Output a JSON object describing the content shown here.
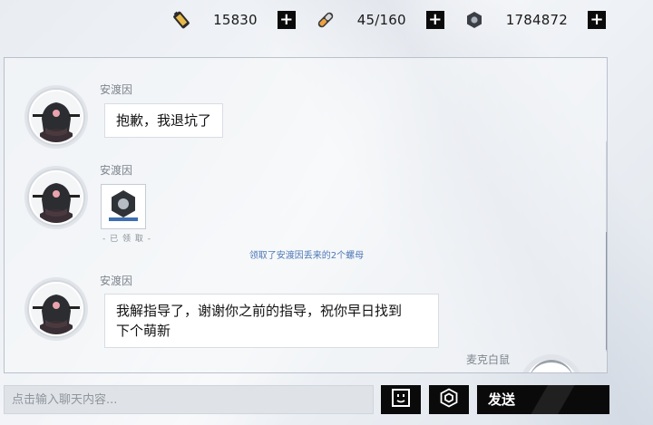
{
  "resources": [
    {
      "icon": "gold-battery-icon",
      "value": "15830"
    },
    {
      "icon": "stamina-capsule-icon",
      "value": "45/160"
    },
    {
      "icon": "hex-nut-icon",
      "value": "1784872"
    }
  ],
  "chat": {
    "messages": [
      {
        "sender": "安渡因",
        "text": "抱歉，我退坑了"
      },
      {
        "sender": "安渡因",
        "gift_status": "- 已 领 取 -"
      },
      {
        "sender": "安渡因",
        "text_line1": "我解指导了，谢谢你之前的指导，祝你早日找到",
        "text_line2": "下个萌新"
      }
    ],
    "system_notice": "领取了安渡因丢来的2个螺母",
    "partial_sender": "麦克白鼠"
  },
  "input": {
    "placeholder": "点击输入聊天内容..."
  },
  "buttons": {
    "send_label": "发送",
    "emoji_icon": "face-icon",
    "extra_icon": "gear-hex-icon"
  }
}
